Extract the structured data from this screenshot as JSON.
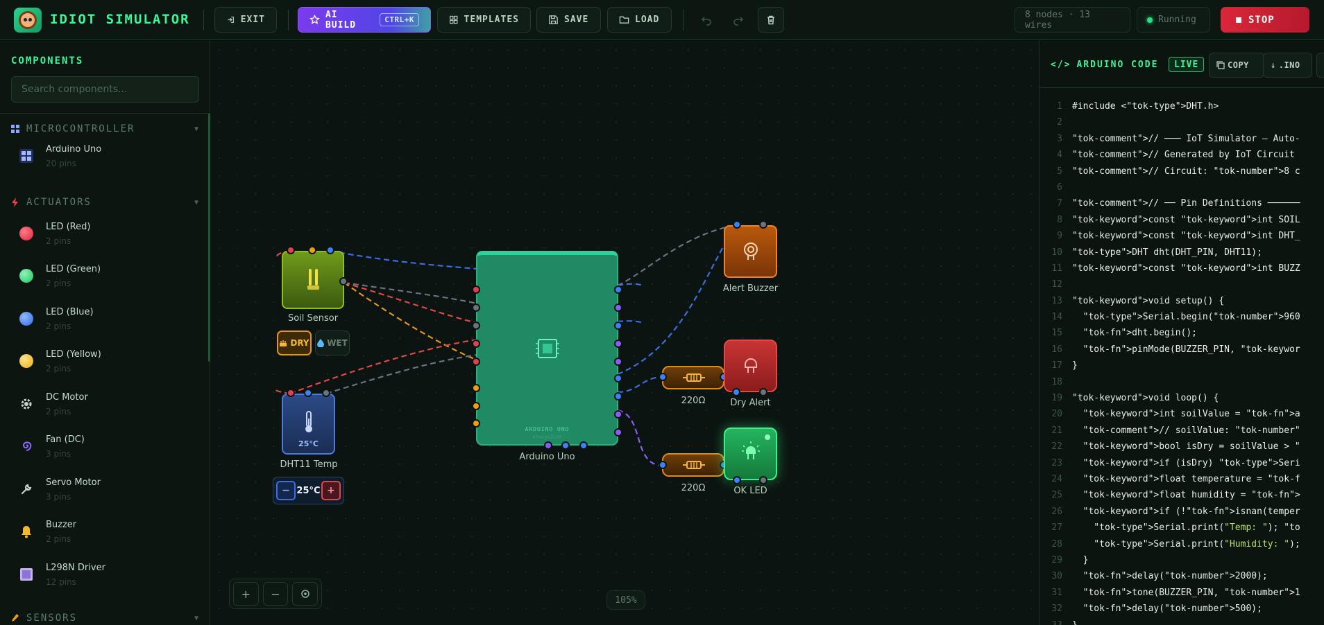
{
  "app": {
    "title": "IDIOT SIMULATOR"
  },
  "toolbar": {
    "exit_label": "EXIT",
    "ai_build_label": "AI BUILD",
    "ai_build_shortcut": "CTRL+K",
    "templates_label": "TEMPLATES",
    "save_label": "SAVE",
    "load_label": "LOAD",
    "stats": "8 nodes · 13 wires",
    "status": "Running",
    "stop_label": "STOP"
  },
  "sidebar": {
    "title": "COMPONENTS",
    "search_placeholder": "Search components...",
    "categories": [
      {
        "label": "MICROCONTROLLER",
        "items": [
          {
            "name": "Arduino Uno",
            "pins": "20 pins"
          }
        ]
      },
      {
        "label": "ACTUATORS",
        "items": [
          {
            "name": "LED (Red)",
            "pins": "2 pins"
          },
          {
            "name": "LED (Green)",
            "pins": "2 pins"
          },
          {
            "name": "LED (Blue)",
            "pins": "2 pins"
          },
          {
            "name": "LED (Yellow)",
            "pins": "2 pins"
          },
          {
            "name": "DC Motor",
            "pins": "2 pins"
          },
          {
            "name": "Fan (DC)",
            "pins": "3 pins"
          },
          {
            "name": "Servo Motor",
            "pins": "3 pins"
          },
          {
            "name": "Buzzer",
            "pins": "2 pins"
          },
          {
            "name": "L298N Driver",
            "pins": "12 pins"
          }
        ]
      },
      {
        "label": "SENSORS",
        "items": []
      }
    ]
  },
  "canvas": {
    "nodes": {
      "soil_sensor": "Soil Sensor",
      "dry_toggle": "DRY",
      "wet_toggle": "WET",
      "dht11": "DHT11 Temp",
      "dht11_readout": "25°C",
      "temp_value": "25°C",
      "temp_minus": "−",
      "temp_plus": "+",
      "arduino": "Arduino Uno",
      "arduino_chip_label": "ARDUINO UNO",
      "arduino_chip_sub": "ATmega328P",
      "buzzer": "Alert Buzzer",
      "resistor1": "220Ω",
      "dry_alert": "Dry Alert",
      "resistor2": "220Ω",
      "ok_led": "OK LED"
    },
    "zoom": "105%",
    "zoom_in": "+",
    "zoom_out": "−"
  },
  "code_panel": {
    "title": "ARDUINO CODE",
    "live_label": "LIVE",
    "copy_label": "COPY",
    "ino_label": ".INO",
    "lines": [
      "#include <\"tok-type\">DHT.h>",
      "",
      "\"tok-comment\">// ─── IoT Simulator — Auto-",
      "\"tok-comment\">// Generated by IoT Circuit",
      "\"tok-comment\">// Circuit: \"tok-number\">8 c",
      "",
      "\"tok-comment\">// ── Pin Definitions ──────",
      "\"tok-keyword\">const \"tok-keyword\">int SOIL",
      "\"tok-keyword\">const \"tok-keyword\">int DHT_",
      "\"tok-type\">DHT dht(DHT_PIN, DHT11);",
      "\"tok-keyword\">const \"tok-keyword\">int BUZZ",
      "",
      "\"tok-keyword\">void setup() {",
      "  \"tok-type\">Serial.begin(\"tok-number\">960",
      "  \"tok-fn\">dht.begin();",
      "  \"tok-fn\">pinMode(BUZZER_PIN, \"tok-keywor",
      "}",
      "",
      "\"tok-keyword\">void loop() {",
      "  \"tok-keyword\">int soilValue = \"tok-fn\">a",
      "  \"tok-comment\">// soilValue: \"tok-number\"",
      "  \"tok-keyword\">bool isDry = soilValue > \"",
      "  \"tok-keyword\">if (isDry) \"tok-type\">Seri",
      "  \"tok-keyword\">float temperature = \"tok-f",
      "  \"tok-keyword\">float humidity = \"tok-fn\">",
      "  \"tok-keyword\">if (!\"tok-fn\">isnan(temper",
      "    \"tok-type\">Serial.print(\"Temp: \"); \"to",
      "    \"tok-type\">Serial.print(\"Humidity: \");",
      "  }",
      "  \"tok-fn\">delay(\"tok-number\">2000);",
      "  \"tok-fn\">tone(BUZZER_PIN, \"tok-number\">1",
      "  \"tok-fn\">delay(\"tok-number\">500);",
      "}"
    ]
  },
  "colors": {
    "accent": "#3ff59a",
    "stop": "#d9273a",
    "ai": "#7c3aed"
  }
}
